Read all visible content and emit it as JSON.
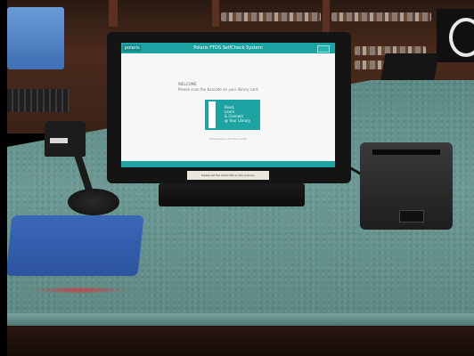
{
  "screen": {
    "logo": "polaris",
    "title": "Polaris FTDS SelfCheck System",
    "welcome_heading": "WELCOME",
    "welcome_prompt": "Please scan the barcode on your library card",
    "card_lines": [
      "Read,",
      "Learn",
      "& Connect",
      "@ Your Library"
    ],
    "hint": "Please place card face down",
    "label_tape": "Please set the items flat on the scanner"
  },
  "colors": {
    "screen_accent": "#1ea3a3",
    "counter": "#6d9a94",
    "mousepad": "#3b67b8"
  }
}
